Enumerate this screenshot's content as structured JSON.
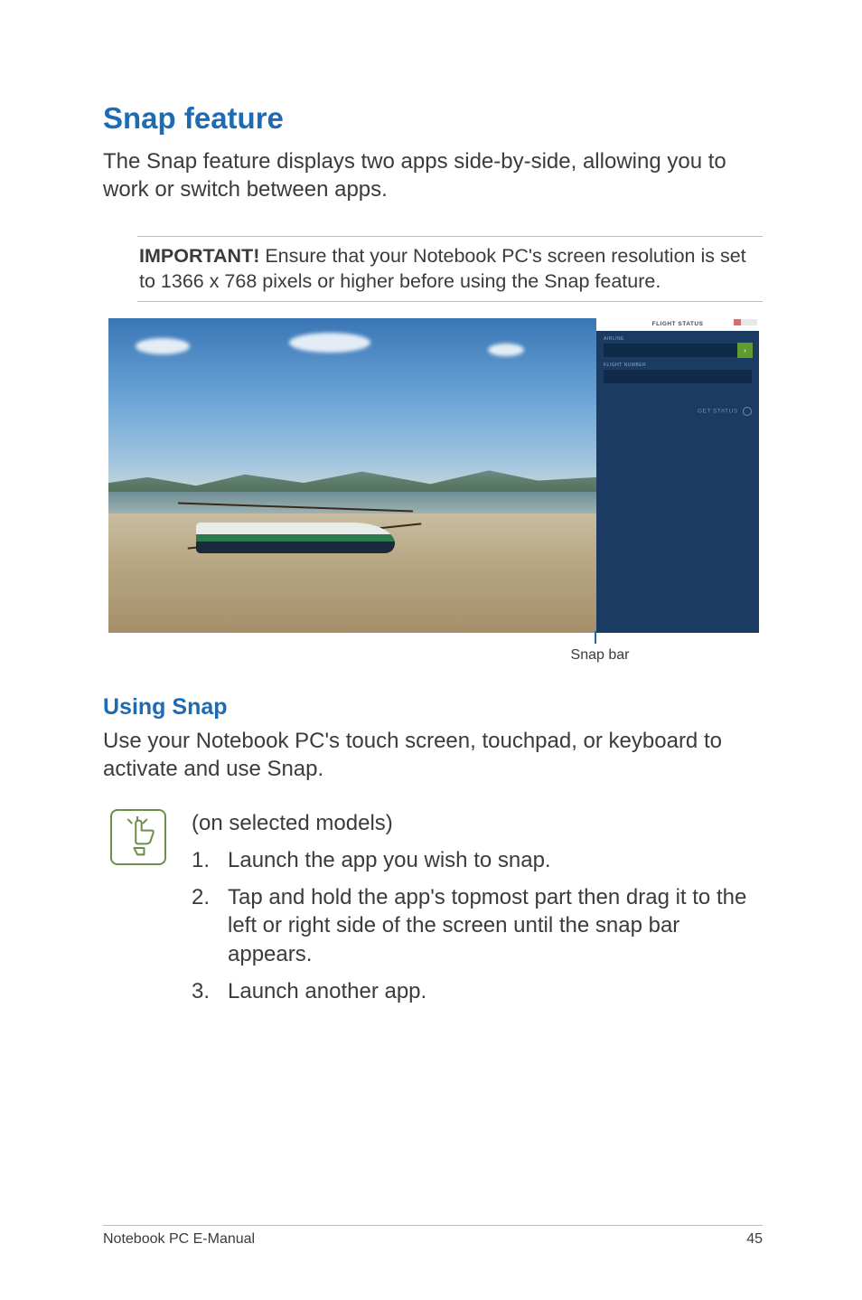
{
  "heading": "Snap feature",
  "intro": "The Snap feature displays two apps side-by-side, allowing you to work or switch between apps.",
  "note_strong": "IMPORTANT!",
  "note_body": " Ensure that your Notebook PC's screen resolution is set to 1366 x 768 pixels or higher before using the Snap feature.",
  "snap_caption": "Snap bar",
  "subheading": "Using Snap",
  "sub_intro": "Use your Notebook PC's touch screen, touchpad, or keyboard to activate and use Snap.",
  "selected_models": "(on selected models)",
  "steps": [
    {
      "num": "1.",
      "text": "Launch the app you wish to snap."
    },
    {
      "num": "2.",
      "text": "Tap and hold the app's topmost part then drag it to the left or right side of the screen until the snap bar appears."
    },
    {
      "num": "3.",
      "text": "Launch another app."
    }
  ],
  "footer_left": "Notebook PC E-Manual",
  "footer_right": "45",
  "app_panel": {
    "title": "FLIGHT STATUS",
    "label1": "AIRLINE",
    "label2": "FLIGHT NUMBER",
    "go": "›",
    "status": "GET STATUS"
  }
}
